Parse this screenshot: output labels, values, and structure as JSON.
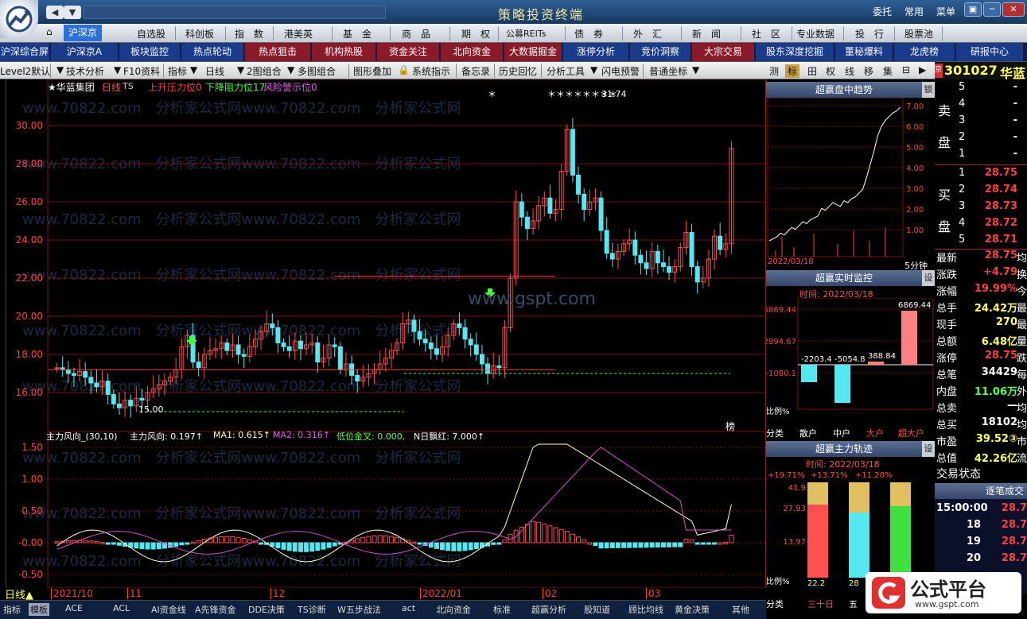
{
  "window": {
    "title": "策略投资终端",
    "right_menu": [
      "委托",
      "常用",
      "菜单"
    ],
    "win_buttons": [
      "▣",
      "─",
      "☐",
      "✕"
    ]
  },
  "menubar": {
    "items": [
      "沪深京",
      "自选股",
      "科创板",
      "指　数",
      "港美英",
      "基　金",
      "商　品",
      "期　权",
      "公募REITs",
      "债　券",
      "外　汇",
      "新　闻",
      "社　区",
      "专业数据",
      "投　行",
      "股票池"
    ]
  },
  "submenu": {
    "items": [
      {
        "label": "沪深综合屏",
        "bg": "#1a3a8a"
      },
      {
        "label": "沪深京A",
        "bg": "#1a3a8a"
      },
      {
        "label": "板块监控",
        "bg": "#1a3a8a"
      },
      {
        "label": "热点轮动",
        "bg": "#1a3a8a"
      },
      {
        "label": "热点狙击",
        "bg": "#8a1a2a"
      },
      {
        "label": "机构热股",
        "bg": "#8a1a2a"
      },
      {
        "label": "资金关注",
        "bg": "#8a1a2a"
      },
      {
        "label": "北向资金",
        "bg": "#8a1a2a"
      },
      {
        "label": "大数据掘金",
        "bg": "#8a1a2a"
      },
      {
        "label": "涨停分析",
        "bg": "#1a3a8a"
      },
      {
        "label": "竞价洞察",
        "bg": "#1a3a8a"
      },
      {
        "label": "大宗交易",
        "bg": "#8a1a2a"
      },
      {
        "label": "股东深度挖掘",
        "bg": "#1a3a8a"
      },
      {
        "label": "董秘爆料",
        "bg": "#1a3a8a"
      },
      {
        "label": "龙虎榜",
        "bg": "#1a3a8a"
      },
      {
        "label": "研报中心",
        "bg": "#1a3a8a"
      }
    ]
  },
  "toolbar": {
    "items": [
      "Level2默认",
      "技术分析",
      "F10资料",
      "指标",
      "日线",
      "2图组合",
      "多图组合",
      "图形叠加",
      "系统指示",
      "备忘录",
      "历史回忆",
      "分析工具",
      "闪电预警",
      "普通坐标"
    ],
    "right_tabs": [
      "测",
      "标",
      "田",
      "权",
      "线",
      "移",
      "集"
    ]
  },
  "stock": {
    "code": "301027",
    "name_short": "华蓝",
    "header_name": "★华蓝集团",
    "period": "日线",
    "ts": "TS",
    "line1": "上升压力位0",
    "line2": "下降阻力位17",
    "line3": "风险警示位0",
    "peak_label": "31.74",
    "low_label": "15.00",
    "watermark_center": "www.gspt.com",
    "bang": "榜"
  },
  "price_axis": {
    "labels": [
      "30.00",
      "28.00",
      "26.00",
      "24.00",
      "22.00",
      "20.00",
      "18.00",
      "16.00"
    ]
  },
  "indicator": {
    "name": "主力风向_(30,10)",
    "values": "主力风向: 0.197↑",
    "ma1": "MA1: 0.615↑",
    "ma2": "MA2: 0.316↑",
    "low": "低位金叉: 0.000,",
    "red": "N日飘红: 7.000↑",
    "axis": [
      "1.50",
      "1.00",
      "0.50",
      "-0.00",
      "-0.50"
    ]
  },
  "date_axis": {
    "period": "日线▲",
    "labels": [
      "2021/10",
      "11",
      "12",
      "2022/01",
      "02",
      "03"
    ]
  },
  "bottom_tabs": [
    "指标",
    "模板",
    "ACE",
    "ACL",
    "AI资金线",
    "A先锋资金",
    "DDE决策",
    "TS诊断",
    "W五步战法",
    "act",
    "北向资金",
    "标准",
    "超赢分析",
    "股知道",
    "顾比均线",
    "黄金决策",
    "其他"
  ],
  "right_panel": {
    "trend_title": "超赢盘中趋势",
    "trend_lock": "锁",
    "trend_axis": [
      "7.00",
      "6.00",
      "5.00",
      "4.00",
      "3.00",
      "2.00",
      "1.00"
    ],
    "trend_date": "2022/03/18",
    "trend_period": "5分钟",
    "monitor_title": "超赢实时监控",
    "monitor_time": "时间: 2022/03/18",
    "monitor_axis": [
      "6869.44",
      "2894.67",
      "-1080.1"
    ],
    "monitor_vals": [
      "-2203.4",
      "-5054.8",
      "388.84",
      "6869.44"
    ],
    "monitor_ratio": "比例%",
    "monitor_cats": [
      "分类",
      "散户",
      "中户",
      "大户",
      "超大户"
    ],
    "track_title": "超赢主力轨迹",
    "track_time": "时间: 2022/03/18",
    "track_pcts": [
      "+19.71%",
      "+13.71%",
      "+11.20%"
    ],
    "track_axis": [
      "41.9",
      "27.93",
      "13.97"
    ],
    "track_ratio": "比例%",
    "track_bottom": [
      "22.2",
      "28"
    ],
    "track_cats": [
      "分类",
      "三十日",
      "五"
    ],
    "set": "设"
  },
  "quote": {
    "sell_label": [
      "卖",
      "盘"
    ],
    "buy_label": [
      "买",
      "盘"
    ],
    "sell": [
      {
        "n": "5",
        "p": "-"
      },
      {
        "n": "4",
        "p": "-"
      },
      {
        "n": "3",
        "p": "-"
      },
      {
        "n": "2",
        "p": "-"
      },
      {
        "n": "1",
        "p": "-"
      }
    ],
    "buy": [
      {
        "n": "1",
        "p": "28.75"
      },
      {
        "n": "2",
        "p": "28.74"
      },
      {
        "n": "3",
        "p": "28.73"
      },
      {
        "n": "4",
        "p": "28.72"
      },
      {
        "n": "5",
        "p": "28.71"
      }
    ],
    "stats": [
      {
        "l": "最新",
        "v": "28.75",
        "e": "均",
        "c": "#ff4040"
      },
      {
        "l": "涨跌",
        "v": "+4.79",
        "e": "换",
        "c": "#ff4040"
      },
      {
        "l": "涨幅",
        "v": "19.99%",
        "e": "今",
        "c": "#ff4040"
      },
      {
        "l": "总手",
        "v": "24.42万",
        "e": "最",
        "c": "#ffff66"
      },
      {
        "l": "现手",
        "v": "270",
        "e": "最",
        "c": "#ffff66"
      },
      {
        "l": "总额",
        "v": "6.48亿",
        "e": "量",
        "c": "#ffff66"
      },
      {
        "l": "涨停",
        "v": "28.75",
        "e": "跌",
        "c": "#ff4040"
      },
      {
        "l": "总笔",
        "v": "34429",
        "e": "每",
        "c": "#ffffff"
      },
      {
        "l": "内盘",
        "v": "11.06万",
        "e": "外",
        "c": "#55ff55"
      },
      {
        "l": "总卖",
        "v": "—",
        "e": "均",
        "c": "#ffffff"
      },
      {
        "l": "总买",
        "v": "18102",
        "e": "均",
        "c": "#ffffff"
      },
      {
        "l": "市盈",
        "v": "39.52③",
        "e": "市",
        "c": "#ffff66"
      },
      {
        "l": "总值",
        "v": "42.26亿",
        "e": "流",
        "c": "#ffff66"
      }
    ],
    "status": "交易状态",
    "detail_title": "逐笔成交",
    "ticks": [
      {
        "t": "15:00:00",
        "p": "28.7"
      },
      {
        "t": "18",
        "p": "28.7"
      },
      {
        "t": "19",
        "p": "28.7"
      },
      {
        "t": "20",
        "p": "28.7"
      }
    ]
  },
  "badge": {
    "text": "公式平台",
    "url": "www.gspt.com"
  },
  "colors": {
    "up": "#ff4d4d",
    "down": "#54e8f0",
    "grid": "#7a1010",
    "ma1": "#ffffcc",
    "ma2": "#d050d0"
  }
}
